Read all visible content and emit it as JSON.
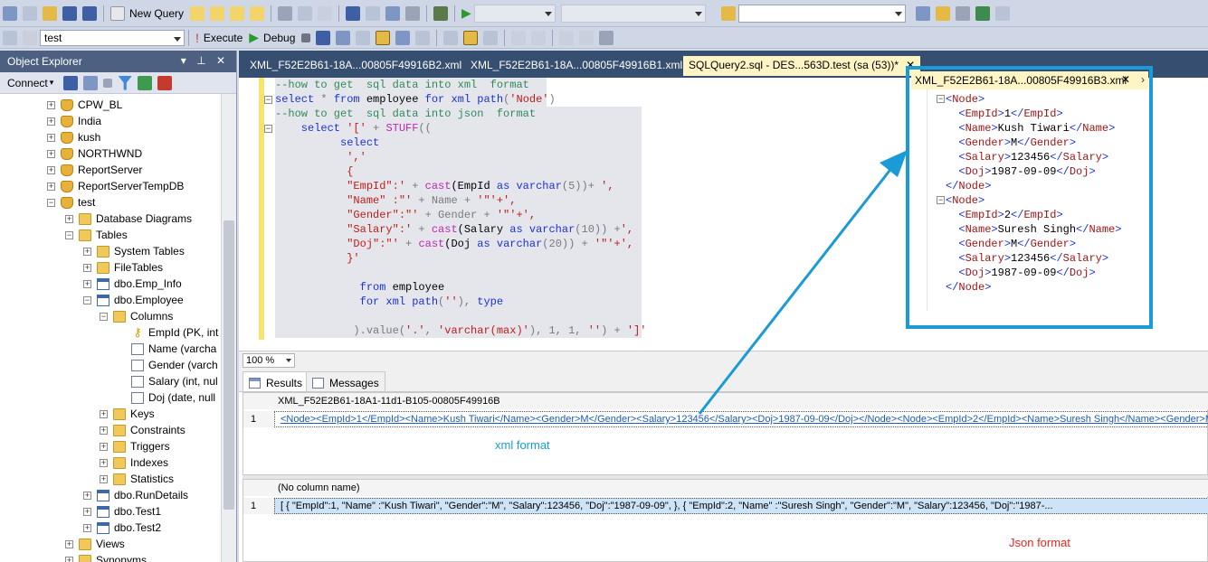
{
  "toolbar1": {
    "new_query_label": "New Query",
    "database_combo_value": "",
    "search_combo_value": ""
  },
  "toolbar2": {
    "db_selector_value": "test",
    "execute_label": "Execute",
    "debug_label": "Debug"
  },
  "object_explorer": {
    "title": "Object Explorer",
    "title_controls": "▾ ⊥ ✕",
    "connect_label": "Connect",
    "nodes": [
      {
        "label": "CPW_BL",
        "type": "db",
        "level": 3,
        "exp": "+"
      },
      {
        "label": "India",
        "type": "db",
        "level": 3,
        "exp": "+"
      },
      {
        "label": "kush",
        "type": "db",
        "level": 3,
        "exp": "+"
      },
      {
        "label": "NORTHWND",
        "type": "db",
        "level": 3,
        "exp": "+"
      },
      {
        "label": "ReportServer",
        "type": "db",
        "level": 3,
        "exp": "+"
      },
      {
        "label": "ReportServerTempDB",
        "type": "db",
        "level": 3,
        "exp": "+"
      },
      {
        "label": "test",
        "type": "db",
        "level": 3,
        "exp": "−"
      },
      {
        "label": "Database Diagrams",
        "type": "folder",
        "level": 4,
        "exp": "+"
      },
      {
        "label": "Tables",
        "type": "folder",
        "level": 4,
        "exp": "−"
      },
      {
        "label": "System Tables",
        "type": "folder",
        "level": 5,
        "exp": "+"
      },
      {
        "label": "FileTables",
        "type": "folder",
        "level": 5,
        "exp": "+"
      },
      {
        "label": "dbo.Emp_Info",
        "type": "table",
        "level": 5,
        "exp": "+"
      },
      {
        "label": "dbo.Employee",
        "type": "table",
        "level": 5,
        "exp": "−"
      },
      {
        "label": "Columns",
        "type": "folder",
        "level": 6,
        "exp": "−"
      },
      {
        "label": "EmpId (PK, int",
        "type": "key",
        "level": 7,
        "exp": ""
      },
      {
        "label": "Name (varcha",
        "type": "col",
        "level": 7,
        "exp": ""
      },
      {
        "label": "Gender (varch",
        "type": "col",
        "level": 7,
        "exp": ""
      },
      {
        "label": "Salary (int, nul",
        "type": "col",
        "level": 7,
        "exp": ""
      },
      {
        "label": "Doj (date, null",
        "type": "col",
        "level": 7,
        "exp": ""
      },
      {
        "label": "Keys",
        "type": "folder",
        "level": 6,
        "exp": "+"
      },
      {
        "label": "Constraints",
        "type": "folder",
        "level": 6,
        "exp": "+"
      },
      {
        "label": "Triggers",
        "type": "folder",
        "level": 6,
        "exp": "+"
      },
      {
        "label": "Indexes",
        "type": "folder",
        "level": 6,
        "exp": "+"
      },
      {
        "label": "Statistics",
        "type": "folder",
        "level": 6,
        "exp": "+"
      },
      {
        "label": "dbo.RunDetails",
        "type": "table",
        "level": 5,
        "exp": "+"
      },
      {
        "label": "dbo.Test1",
        "type": "table",
        "level": 5,
        "exp": "+"
      },
      {
        "label": "dbo.Test2",
        "type": "table",
        "level": 5,
        "exp": "+"
      },
      {
        "label": "Views",
        "type": "folder",
        "level": 4,
        "exp": "+"
      },
      {
        "label": "Synonyms",
        "type": "folder",
        "level": 4,
        "exp": "+"
      }
    ]
  },
  "tabs": [
    {
      "label": "XML_F52E2B61-18A...00805F49916B2.xml",
      "active": false
    },
    {
      "label": "XML_F52E2B61-18A...00805F49916B1.xml",
      "active": false
    },
    {
      "label": "SQLQuery2.sql - DES...563D.test (sa (53))*",
      "active": true
    }
  ],
  "editor": {
    "sql_lines": [
      [
        {
          "t": "--how to get  sql data into xml  format",
          "c": "cm"
        }
      ],
      [
        {
          "t": "select",
          "c": "kw"
        },
        {
          "t": " * ",
          "c": "op"
        },
        {
          "t": "from",
          "c": "kw"
        },
        {
          "t": " employee ",
          "c": ""
        },
        {
          "t": "for",
          "c": "kw"
        },
        {
          "t": " ",
          "c": ""
        },
        {
          "t": "xml",
          "c": "kw"
        },
        {
          "t": " ",
          "c": ""
        },
        {
          "t": "path",
          "c": "kw"
        },
        {
          "t": "(",
          "c": "op"
        },
        {
          "t": "'Node'",
          "c": "st"
        },
        {
          "t": ")",
          "c": "op"
        }
      ],
      [
        {
          "t": "--how to get  sql data into json  format",
          "c": "cm"
        }
      ],
      [
        {
          "t": "    select",
          "c": "kw"
        },
        {
          "t": " ",
          "c": ""
        },
        {
          "t": "'['",
          "c": "st"
        },
        {
          "t": " + ",
          "c": "op"
        },
        {
          "t": "STUFF",
          "c": "fn"
        },
        {
          "t": "((",
          "c": "op"
        }
      ],
      [
        {
          "t": "          select",
          "c": "kw"
        }
      ],
      [
        {
          "t": "           ",
          "c": ""
        },
        {
          "t": "','",
          "c": "st"
        }
      ],
      [
        {
          "t": "           {",
          "c": "st"
        }
      ],
      [
        {
          "t": "           \"EmpId\":'",
          "c": "st"
        },
        {
          "t": " + ",
          "c": "op"
        },
        {
          "t": "cast",
          "c": "fn"
        },
        {
          "t": "(EmpId ",
          "c": ""
        },
        {
          "t": "as",
          "c": "kw"
        },
        {
          "t": " ",
          "c": ""
        },
        {
          "t": "varchar",
          "c": "kw"
        },
        {
          "t": "(5))+ ",
          "c": "op"
        },
        {
          "t": "',",
          "c": "st"
        }
      ],
      [
        {
          "t": "           \"Name\" :\"'",
          "c": "st"
        },
        {
          "t": " + Name + ",
          "c": "op"
        },
        {
          "t": "'\"'+',",
          "c": "st"
        }
      ],
      [
        {
          "t": "           \"Gender\":\"'",
          "c": "st"
        },
        {
          "t": " + Gender + ",
          "c": "op"
        },
        {
          "t": "'\"'+',",
          "c": "st"
        }
      ],
      [
        {
          "t": "           \"Salary\":'",
          "c": "st"
        },
        {
          "t": " + ",
          "c": "op"
        },
        {
          "t": "cast",
          "c": "fn"
        },
        {
          "t": "(Salary ",
          "c": ""
        },
        {
          "t": "as",
          "c": "kw"
        },
        {
          "t": " ",
          "c": ""
        },
        {
          "t": "varchar",
          "c": "kw"
        },
        {
          "t": "(10)) +",
          "c": "op"
        },
        {
          "t": "',",
          "c": "st"
        }
      ],
      [
        {
          "t": "           \"Doj\":\"'",
          "c": "st"
        },
        {
          "t": " + ",
          "c": "op"
        },
        {
          "t": "cast",
          "c": "fn"
        },
        {
          "t": "(Doj ",
          "c": ""
        },
        {
          "t": "as",
          "c": "kw"
        },
        {
          "t": " ",
          "c": ""
        },
        {
          "t": "varchar",
          "c": "kw"
        },
        {
          "t": "(20)) + ",
          "c": "op"
        },
        {
          "t": "'\"'+',",
          "c": "st"
        }
      ],
      [
        {
          "t": "           }'",
          "c": "st"
        }
      ],
      [
        {
          "t": "",
          "c": ""
        }
      ],
      [
        {
          "t": "             from",
          "c": "kw"
        },
        {
          "t": " employee",
          "c": ""
        }
      ],
      [
        {
          "t": "             for",
          "c": "kw"
        },
        {
          "t": " ",
          "c": ""
        },
        {
          "t": "xml",
          "c": "kw"
        },
        {
          "t": " ",
          "c": ""
        },
        {
          "t": "path",
          "c": "kw"
        },
        {
          "t": "(",
          "c": "op"
        },
        {
          "t": "''",
          "c": "st"
        },
        {
          "t": "), ",
          "c": "op"
        },
        {
          "t": "type",
          "c": "kw"
        }
      ],
      [
        {
          "t": "",
          "c": ""
        }
      ],
      [
        {
          "t": "            ).value(",
          "c": "op"
        },
        {
          "t": "'.'",
          "c": "st"
        },
        {
          "t": ", ",
          "c": "op"
        },
        {
          "t": "'varchar(max)'",
          "c": "st"
        },
        {
          "t": "), 1, 1, ",
          "c": "op"
        },
        {
          "t": "''",
          "c": "st"
        },
        {
          "t": ") + ",
          "c": "op"
        },
        {
          "t": "']'",
          "c": "st"
        }
      ]
    ]
  },
  "xml_panel": {
    "tab_label": "XML_F52E2B61-18A...00805F49916B3.xml",
    "close_label": "✕",
    "lines": [
      [
        {
          "t": "<",
          "c": "xb"
        },
        {
          "t": "Node",
          "c": "xt"
        },
        {
          "t": ">",
          "c": "xb"
        }
      ],
      [
        {
          "t": "  <",
          "c": "xb"
        },
        {
          "t": "EmpId",
          "c": "xt"
        },
        {
          "t": ">",
          "c": "xb"
        },
        {
          "t": "1",
          "c": ""
        },
        {
          "t": "</",
          "c": "xb"
        },
        {
          "t": "EmpId",
          "c": "xt"
        },
        {
          "t": ">",
          "c": "xb"
        }
      ],
      [
        {
          "t": "  <",
          "c": "xb"
        },
        {
          "t": "Name",
          "c": "xt"
        },
        {
          "t": ">",
          "c": "xb"
        },
        {
          "t": "Kush Tiwari",
          "c": ""
        },
        {
          "t": "</",
          "c": "xb"
        },
        {
          "t": "Name",
          "c": "xt"
        },
        {
          "t": ">",
          "c": "xb"
        }
      ],
      [
        {
          "t": "  <",
          "c": "xb"
        },
        {
          "t": "Gender",
          "c": "xt"
        },
        {
          "t": ">",
          "c": "xb"
        },
        {
          "t": "M",
          "c": ""
        },
        {
          "t": "</",
          "c": "xb"
        },
        {
          "t": "Gender",
          "c": "xt"
        },
        {
          "t": ">",
          "c": "xb"
        }
      ],
      [
        {
          "t": "  <",
          "c": "xb"
        },
        {
          "t": "Salary",
          "c": "xt"
        },
        {
          "t": ">",
          "c": "xb"
        },
        {
          "t": "123456",
          "c": ""
        },
        {
          "t": "</",
          "c": "xb"
        },
        {
          "t": "Salary",
          "c": "xt"
        },
        {
          "t": ">",
          "c": "xb"
        }
      ],
      [
        {
          "t": "  <",
          "c": "xb"
        },
        {
          "t": "Doj",
          "c": "xt"
        },
        {
          "t": ">",
          "c": "xb"
        },
        {
          "t": "1987-09-09",
          "c": ""
        },
        {
          "t": "</",
          "c": "xb"
        },
        {
          "t": "Doj",
          "c": "xt"
        },
        {
          "t": ">",
          "c": "xb"
        }
      ],
      [
        {
          "t": "</",
          "c": "xb"
        },
        {
          "t": "Node",
          "c": "xt"
        },
        {
          "t": ">",
          "c": "xb"
        }
      ],
      [
        {
          "t": "<",
          "c": "xb"
        },
        {
          "t": "Node",
          "c": "xt"
        },
        {
          "t": ">",
          "c": "xb"
        }
      ],
      [
        {
          "t": "  <",
          "c": "xb"
        },
        {
          "t": "EmpId",
          "c": "xt"
        },
        {
          "t": ">",
          "c": "xb"
        },
        {
          "t": "2",
          "c": ""
        },
        {
          "t": "</",
          "c": "xb"
        },
        {
          "t": "EmpId",
          "c": "xt"
        },
        {
          "t": ">",
          "c": "xb"
        }
      ],
      [
        {
          "t": "  <",
          "c": "xb"
        },
        {
          "t": "Name",
          "c": "xt"
        },
        {
          "t": ">",
          "c": "xb"
        },
        {
          "t": "Suresh Singh",
          "c": ""
        },
        {
          "t": "</",
          "c": "xb"
        },
        {
          "t": "Name",
          "c": "xt"
        },
        {
          "t": ">",
          "c": "xb"
        }
      ],
      [
        {
          "t": "  <",
          "c": "xb"
        },
        {
          "t": "Gender",
          "c": "xt"
        },
        {
          "t": ">",
          "c": "xb"
        },
        {
          "t": "M",
          "c": ""
        },
        {
          "t": "</",
          "c": "xb"
        },
        {
          "t": "Gender",
          "c": "xt"
        },
        {
          "t": ">",
          "c": "xb"
        }
      ],
      [
        {
          "t": "  <",
          "c": "xb"
        },
        {
          "t": "Salary",
          "c": "xt"
        },
        {
          "t": ">",
          "c": "xb"
        },
        {
          "t": "123456",
          "c": ""
        },
        {
          "t": "</",
          "c": "xb"
        },
        {
          "t": "Salary",
          "c": "xt"
        },
        {
          "t": ">",
          "c": "xb"
        }
      ],
      [
        {
          "t": "  <",
          "c": "xb"
        },
        {
          "t": "Doj",
          "c": "xt"
        },
        {
          "t": ">",
          "c": "xb"
        },
        {
          "t": "1987-09-09",
          "c": ""
        },
        {
          "t": "</",
          "c": "xb"
        },
        {
          "t": "Doj",
          "c": "xt"
        },
        {
          "t": ">",
          "c": "xb"
        }
      ],
      [
        {
          "t": "</",
          "c": "xb"
        },
        {
          "t": "Node",
          "c": "xt"
        },
        {
          "t": ">",
          "c": "xb"
        }
      ]
    ]
  },
  "zoom": {
    "value": "100 %"
  },
  "results_tabs": [
    {
      "label": "Results",
      "active": true
    },
    {
      "label": "Messages",
      "active": false
    }
  ],
  "grid1": {
    "header": "XML_F52E2B61-18A1-11d1-B105-00805F49916B",
    "row_num": "1",
    "value": "<Node><EmpId>1</EmpId><Name>Kush Tiwari</Name><Gender>M</Gender><Salary>123456</Salary><Doj>1987-09-09</Doj></Node><Node><EmpId>2</EmpId><Name>Suresh Singh</Name><Gender>M</..."
  },
  "grid2": {
    "header": "(No column name)",
    "row_num": "1",
    "value": "[   {    \"EmpId\":1,     \"Name\" :\"Kush Tiwari\",     \"Gender\":\"M\",     \"Salary\":123456,     \"Doj\":\"1987-09-09\",     },   {    \"EmpId\":2,     \"Name\" :\"Suresh Singh\",     \"Gender\":\"M\",     \"Salary\":123456,     \"Doj\":\"1987-..."
  },
  "annotations": {
    "xml_note": "xml format",
    "json_note": "Json format"
  },
  "colors": {
    "annotation_blue": "#1a9ad6",
    "json_note_red": "#e0291d"
  }
}
